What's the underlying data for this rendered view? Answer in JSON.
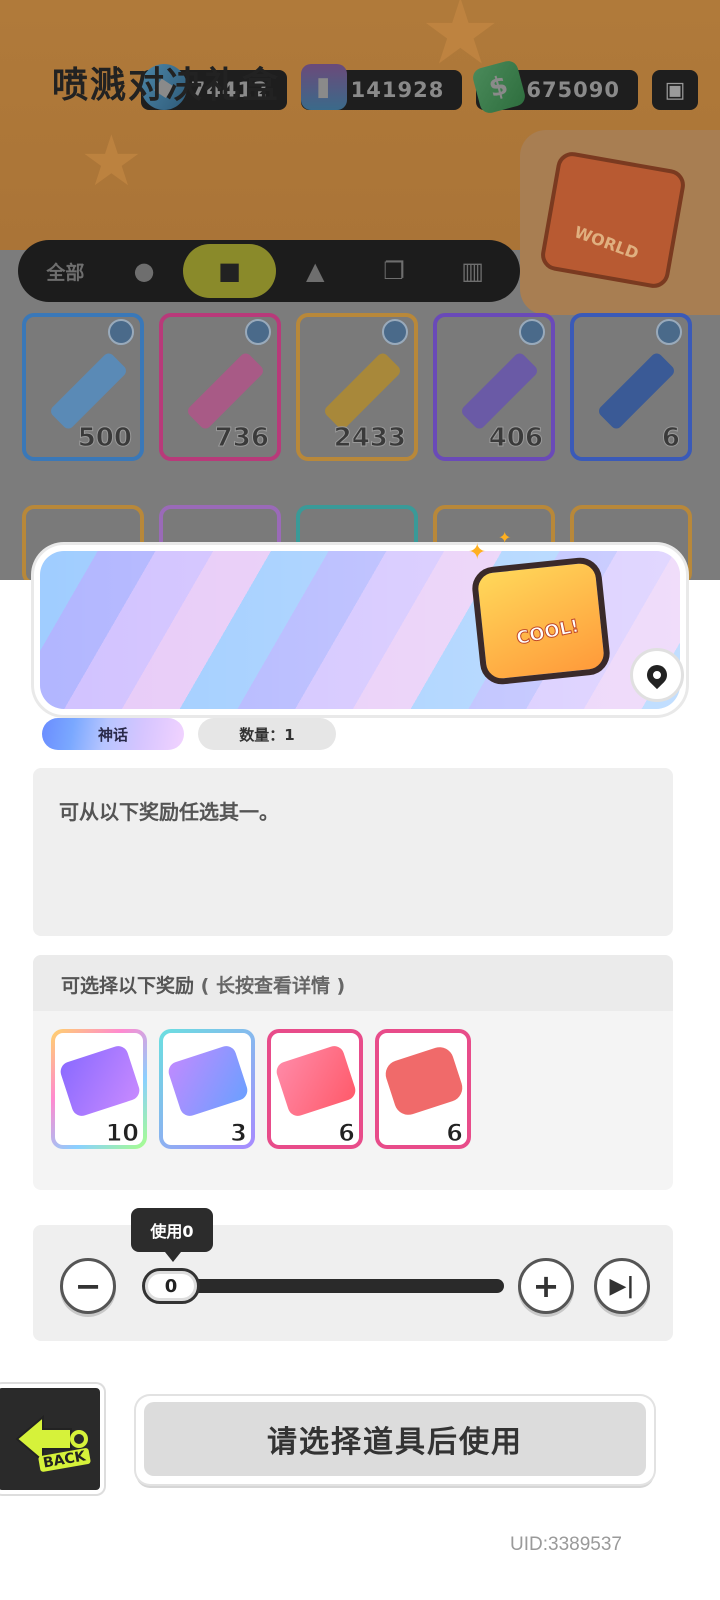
{
  "currency": {
    "gems": "74412",
    "spray": "141928",
    "cash": "675090"
  },
  "tabs": [
    {
      "label": "全部"
    },
    {
      "label": ""
    },
    {
      "label": ""
    },
    {
      "label": ""
    },
    {
      "label": ""
    },
    {
      "label": ""
    }
  ],
  "inventory": [
    {
      "count": "500",
      "color": "#5a9bd6"
    },
    {
      "count": "736",
      "color": "#d65a9b"
    },
    {
      "count": "2433",
      "color": "#d6a23a"
    },
    {
      "count": "406",
      "color": "#8a5ad6"
    },
    {
      "count": "6",
      "color": "#3a6ad6"
    }
  ],
  "promo": {
    "label": "WORLD"
  },
  "item": {
    "title": "喷溅对决礼盒",
    "box_label": "COOL!",
    "rarity": "神话",
    "quantity": "数量：1",
    "description": "可从以下奖励任选其一。"
  },
  "rewards": {
    "header": "可选择以下奖励",
    "hint": "( 长按查看详情 )",
    "items": [
      {
        "count": "10",
        "frame": "rainbow"
      },
      {
        "count": "3",
        "frame": "teal-purple"
      },
      {
        "count": "6",
        "frame": "pink"
      },
      {
        "count": "6",
        "frame": "pink"
      }
    ]
  },
  "slider": {
    "tooltip": "使用0",
    "value": "0",
    "fraction": 0
  },
  "buttons": {
    "back_label": "BACK",
    "confirm_label": "请选择道具后使用"
  },
  "uid": "UID:3389537",
  "colors": {
    "accent": "#d6f23a",
    "dim_orange": "#a97436",
    "panel_grey": "#efefef"
  }
}
